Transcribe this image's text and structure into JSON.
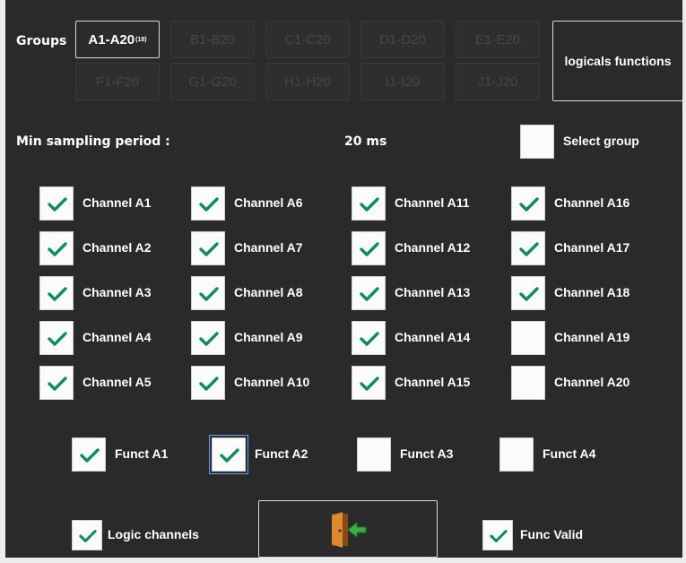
{
  "groups": {
    "label": "Groups",
    "buttons": [
      {
        "label": "A1-A20",
        "sub": "(18)",
        "active": true
      },
      {
        "label": "B1-B20",
        "active": false
      },
      {
        "label": "C1-C20",
        "active": false
      },
      {
        "label": "D1-D20",
        "active": false
      },
      {
        "label": "E1-E20",
        "active": false
      },
      {
        "label": "F1-F20",
        "active": false
      },
      {
        "label": "G1-G20",
        "active": false
      },
      {
        "label": "H1-H20",
        "active": false
      },
      {
        "label": "I1-I20",
        "active": false
      },
      {
        "label": "J1-J20",
        "active": false
      }
    ],
    "logical_functions_label": "logicals functions"
  },
  "sampling": {
    "label": "Min sampling period :",
    "value": "20 ms"
  },
  "select_group": {
    "label": "Select group",
    "checked": false
  },
  "channels": [
    {
      "label": "Channel A1",
      "checked": true
    },
    {
      "label": "Channel A2",
      "checked": true
    },
    {
      "label": "Channel A3",
      "checked": true
    },
    {
      "label": "Channel A4",
      "checked": true
    },
    {
      "label": "Channel A5",
      "checked": true
    },
    {
      "label": "Channel A6",
      "checked": true
    },
    {
      "label": "Channel A7",
      "checked": true
    },
    {
      "label": "Channel A8",
      "checked": true
    },
    {
      "label": "Channel A9",
      "checked": true
    },
    {
      "label": "Channel A10",
      "checked": true
    },
    {
      "label": "Channel A11",
      "checked": true
    },
    {
      "label": "Channel A12",
      "checked": true
    },
    {
      "label": "Channel A13",
      "checked": true
    },
    {
      "label": "Channel A14",
      "checked": true
    },
    {
      "label": "Channel A15",
      "checked": true
    },
    {
      "label": "Channel A16",
      "checked": true
    },
    {
      "label": "Channel A17",
      "checked": true
    },
    {
      "label": "Channel A18",
      "checked": true
    },
    {
      "label": "Channel A19",
      "checked": false
    },
    {
      "label": "Channel A20",
      "checked": false
    }
  ],
  "functs": [
    {
      "label": "Funct A1",
      "checked": true
    },
    {
      "label": "Funct A2",
      "checked": true,
      "focused": true
    },
    {
      "label": "Funct A3",
      "checked": false
    },
    {
      "label": "Funct A4",
      "checked": false
    }
  ],
  "logic_channels": {
    "label": "Logic channels",
    "checked": true
  },
  "func_valid": {
    "label": "Func Valid",
    "checked": true
  },
  "exit_icon": "exit-door-icon",
  "colors": {
    "check": "#0e8c5c",
    "background": "#2a2a2a",
    "exit_arrow": "#3cb043",
    "door": "#c77d2c"
  }
}
